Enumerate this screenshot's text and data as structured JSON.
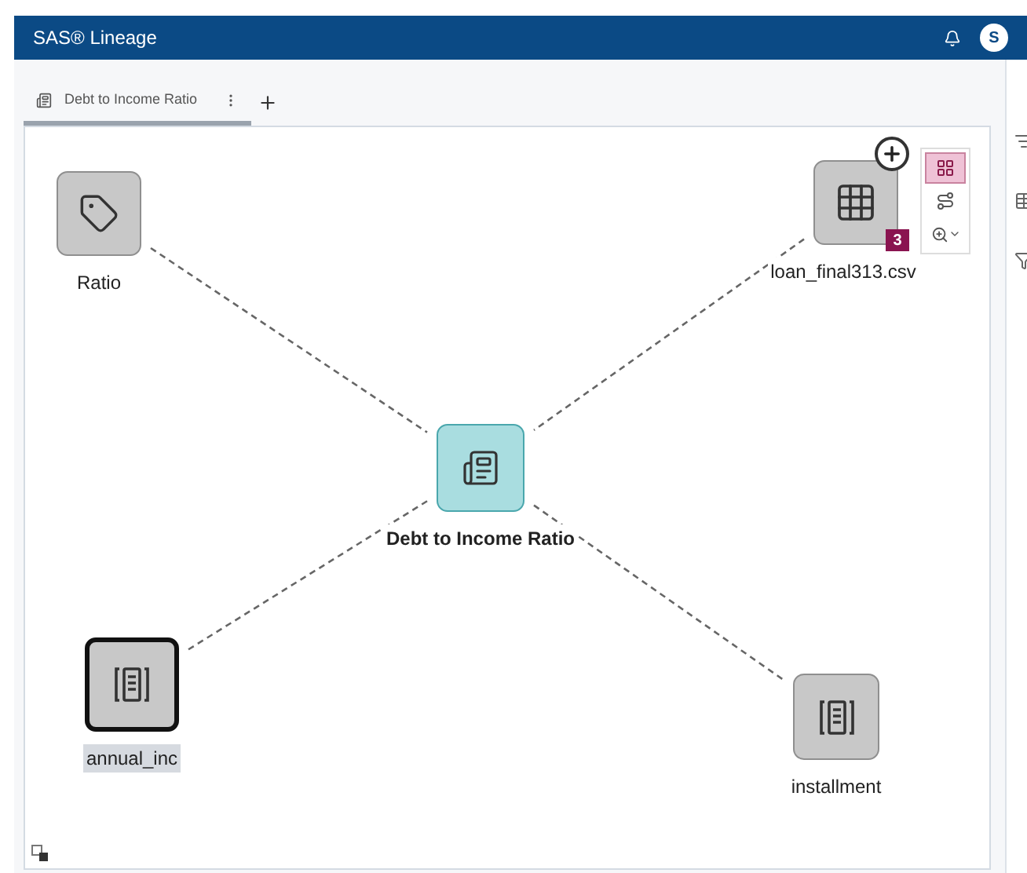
{
  "header": {
    "title": "SAS® Lineage",
    "avatar": "S"
  },
  "tabs": [
    {
      "label": "Debt to Income Ratio",
      "selected": true
    }
  ],
  "nodes": [
    {
      "kind": "tag",
      "label": "Ratio",
      "selected": false,
      "focused": false
    },
    {
      "kind": "table",
      "label": "loan_final313.csv",
      "selected": false,
      "focused": false,
      "badge": "3"
    },
    {
      "kind": "report",
      "label": "Debt to Income Ratio",
      "selected": false,
      "focused": true
    },
    {
      "kind": "column",
      "label": "annual_inc",
      "selected": true,
      "focused": false
    },
    {
      "kind": "column",
      "label": "installment",
      "selected": false,
      "focused": false
    }
  ],
  "node_toolbar": [
    {
      "kind": "layout",
      "selected": true
    },
    {
      "kind": "paths",
      "selected": false
    },
    {
      "kind": "zoom",
      "selected": false
    }
  ]
}
